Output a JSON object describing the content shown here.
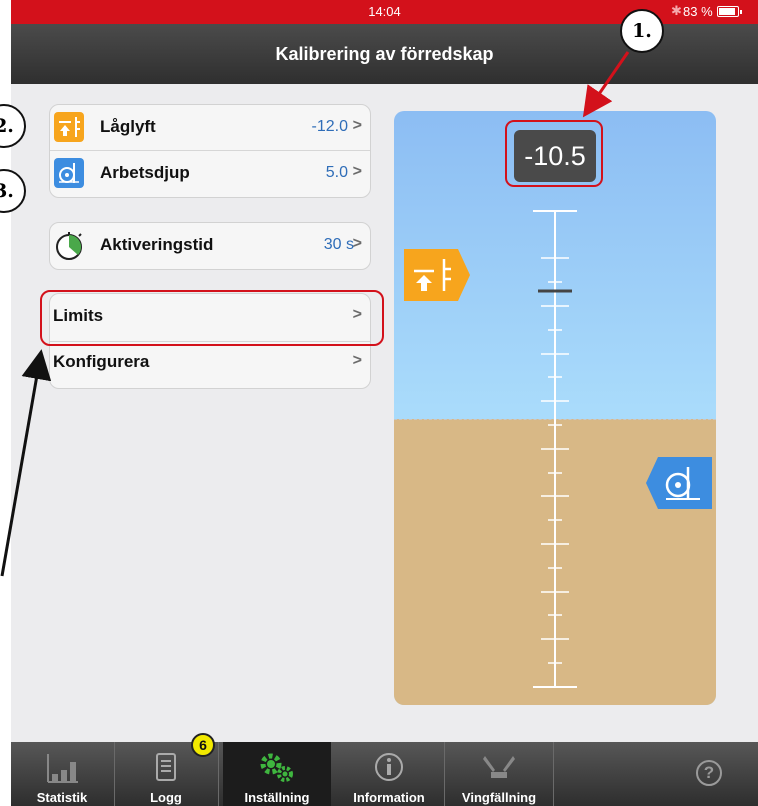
{
  "status": {
    "time": "14:04",
    "bluetooth": "✱",
    "battery": "83 %"
  },
  "nav": {
    "title": "Kalibrering av förredskap"
  },
  "settings": {
    "group1": [
      {
        "label": "Låglyft",
        "value": "-12.0",
        "icon": "lift-low-icon",
        "chevron": ">"
      },
      {
        "label": "Arbetsdjup",
        "value": "5.0",
        "icon": "work-depth-icon",
        "chevron": ">"
      }
    ],
    "group2": [
      {
        "label": "Aktiveringstid",
        "value": "30 s",
        "icon": "timer-icon",
        "chevron": ">"
      }
    ],
    "group3": [
      {
        "label": "Limits",
        "chevron": ">"
      },
      {
        "label": "Konfigurera",
        "chevron": ">"
      }
    ]
  },
  "gauge": {
    "readout": "-10.5",
    "colors": {
      "sky": "#a9dbfb",
      "ground": "#d8b886",
      "orange": "#f7a51d",
      "blue": "#3d8de0"
    }
  },
  "tabs": [
    {
      "label": "Statistik",
      "icon": "bar-chart-icon"
    },
    {
      "label": "Logg",
      "icon": "document-icon",
      "badge": "6"
    },
    {
      "label": "Inställning",
      "icon": "gears-icon"
    },
    {
      "label": "Information",
      "icon": "info-icon"
    },
    {
      "label": "Vingfällning",
      "icon": "wing-fold-icon"
    }
  ],
  "help": "?",
  "callouts": [
    "1.",
    "2.",
    "3."
  ],
  "colors": {
    "statusbar": "#d3111b",
    "callout_line": "#d3111b",
    "link_value": "#2f6db8"
  }
}
